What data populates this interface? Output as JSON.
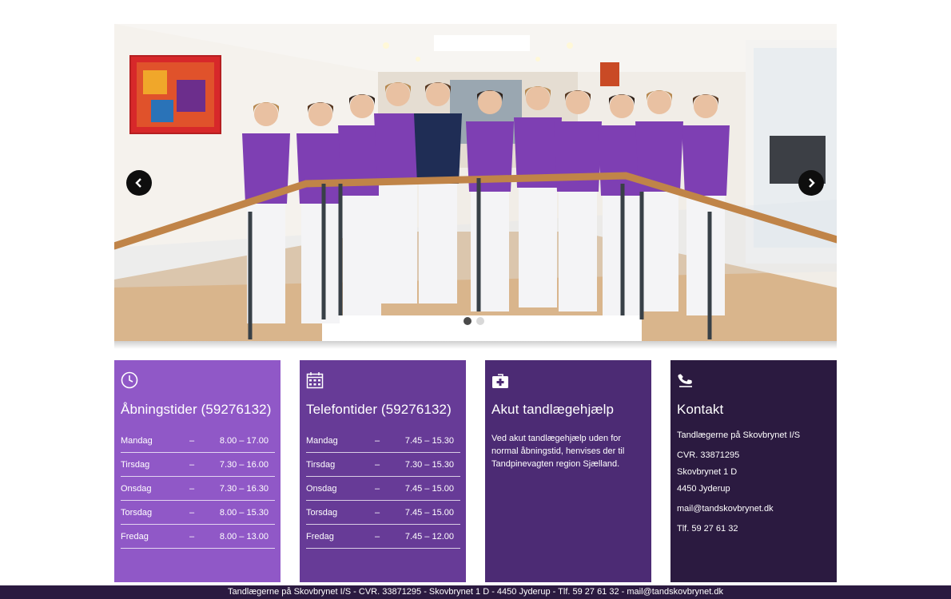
{
  "slider": {
    "image_alt": "Team photo of dental clinic staff",
    "prev_label": "‹",
    "next_label": "›",
    "dots": 2,
    "active_dot": 1
  },
  "boxes": {
    "opening": {
      "icon": "clock-icon",
      "title": "Åbningstider (59276132)",
      "rows": [
        {
          "day": "Mandag",
          "sep": "–",
          "time": "8.00 – 17.00"
        },
        {
          "day": "Tirsdag",
          "sep": "–",
          "time": "7.30 – 16.00"
        },
        {
          "day": "Onsdag",
          "sep": "–",
          "time": "7.30 – 16.30"
        },
        {
          "day": "Torsdag",
          "sep": "–",
          "time": "8.00 – 15.30"
        },
        {
          "day": "Fredag",
          "sep": "–",
          "time": "8.00 – 13.00"
        }
      ]
    },
    "phone": {
      "icon": "calendar-icon",
      "title": "Telefontider (59276132)",
      "rows": [
        {
          "day": "Mandag",
          "sep": "–",
          "time": "7.45 – 15.30"
        },
        {
          "day": "Tirsdag",
          "sep": "–",
          "time": "7.30 – 15.30"
        },
        {
          "day": "Onsdag",
          "sep": "–",
          "time": "7.45 – 15.00"
        },
        {
          "day": "Torsdag",
          "sep": "–",
          "time": "7.45 – 15.00"
        },
        {
          "day": "Fredag",
          "sep": "–",
          "time": "7.45 – 12.00"
        }
      ]
    },
    "emergency": {
      "icon": "first-aid-kit-icon",
      "title": "Akut tandlægehjælp",
      "text": "Ved akut tandlægehjælp uden for normal åbningstid, henvises der til Tandpinevagten region Sjælland."
    },
    "contact": {
      "icon": "phone-icon",
      "title": "Kontakt",
      "company": "Tandlægerne på Skovbrynet I/S",
      "cvr": "CVR. 33871295",
      "street": "Skovbrynet 1 D",
      "city": "4450 Jyderup",
      "email": "mail@tandskovbrynet.dk",
      "phone": "Tlf. 59 27 61 32"
    }
  },
  "footer": {
    "text": "Tandlægerne på Skovbrynet I/S - CVR. 33871295 - Skovbrynet 1 D - 4450 Jyderup - Tlf. 59 27 61 32 - mail@tandskovbrynet.dk"
  },
  "colors": {
    "box1": "#9058c7",
    "box2": "#673b97",
    "box3": "#4c2b74",
    "box4": "#2b1a40",
    "uniform": "#7e3fb3"
  }
}
